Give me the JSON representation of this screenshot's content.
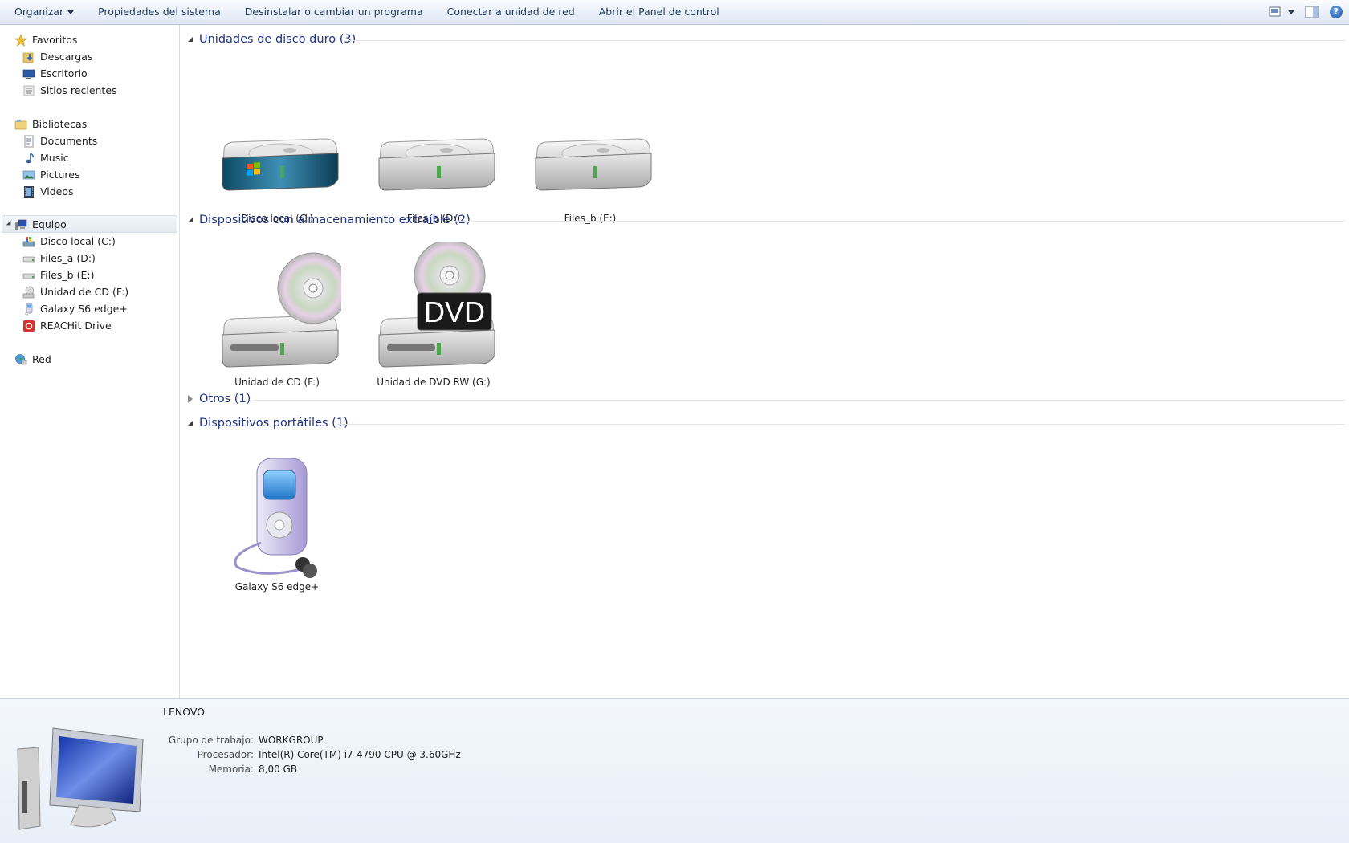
{
  "toolbar": {
    "organize": "Organizar",
    "system_properties": "Propiedades del sistema",
    "uninstall": "Desinstalar o cambiar un programa",
    "map_drive": "Conectar a unidad de red",
    "control_panel": "Abrir el Panel de control",
    "icons": [
      "view-options-icon",
      "preview-pane-icon",
      "help-icon"
    ],
    "help_glyph": "?"
  },
  "nav": {
    "favorites": "Favoritos",
    "downloads": "Descargas",
    "desktop": "Escritorio",
    "recent": "Sitios recientes",
    "libraries": "Bibliotecas",
    "documents": "Documents",
    "music": "Music",
    "pictures": "Pictures",
    "videos": "Videos",
    "computer": "Equipo",
    "drive_c": "Disco local (C:)",
    "drive_d": "Files_a (D:)",
    "drive_e": "Files_b (E:)",
    "drive_f": "Unidad de CD (F:)",
    "galaxy": "Galaxy S6 edge+",
    "reachit": "REACHit Drive",
    "network": "Red"
  },
  "groups": {
    "hard_disks": "Unidades de disco duro (3)",
    "removable": "Dispositivos con almacenamiento extraíble (2)",
    "others": "Otros (1)",
    "portable": "Dispositivos portátiles (1)"
  },
  "tiles": {
    "c": "Disco local (C:)",
    "d": "Files_a (D:)",
    "e": "Files_b (E:)",
    "f": "Unidad de CD (F:)",
    "g": "Unidad de DVD RW (G:)",
    "dvd_badge": "DVD",
    "galaxy": "Galaxy S6 edge+"
  },
  "details": {
    "name": "LENOVO",
    "workgroup_label": "Grupo de trabajo:",
    "workgroup": "WORKGROUP",
    "processor_label": "Procesador:",
    "processor": "Intel(R) Core(TM) i7-4790 CPU @ 3.60GHz",
    "memory_label": "Memoria:",
    "memory": "8,00 GB"
  },
  "colors": {
    "group_header": "#1e3287",
    "toolbar_text": "#1e395b",
    "selection": "#e4eaf2"
  }
}
